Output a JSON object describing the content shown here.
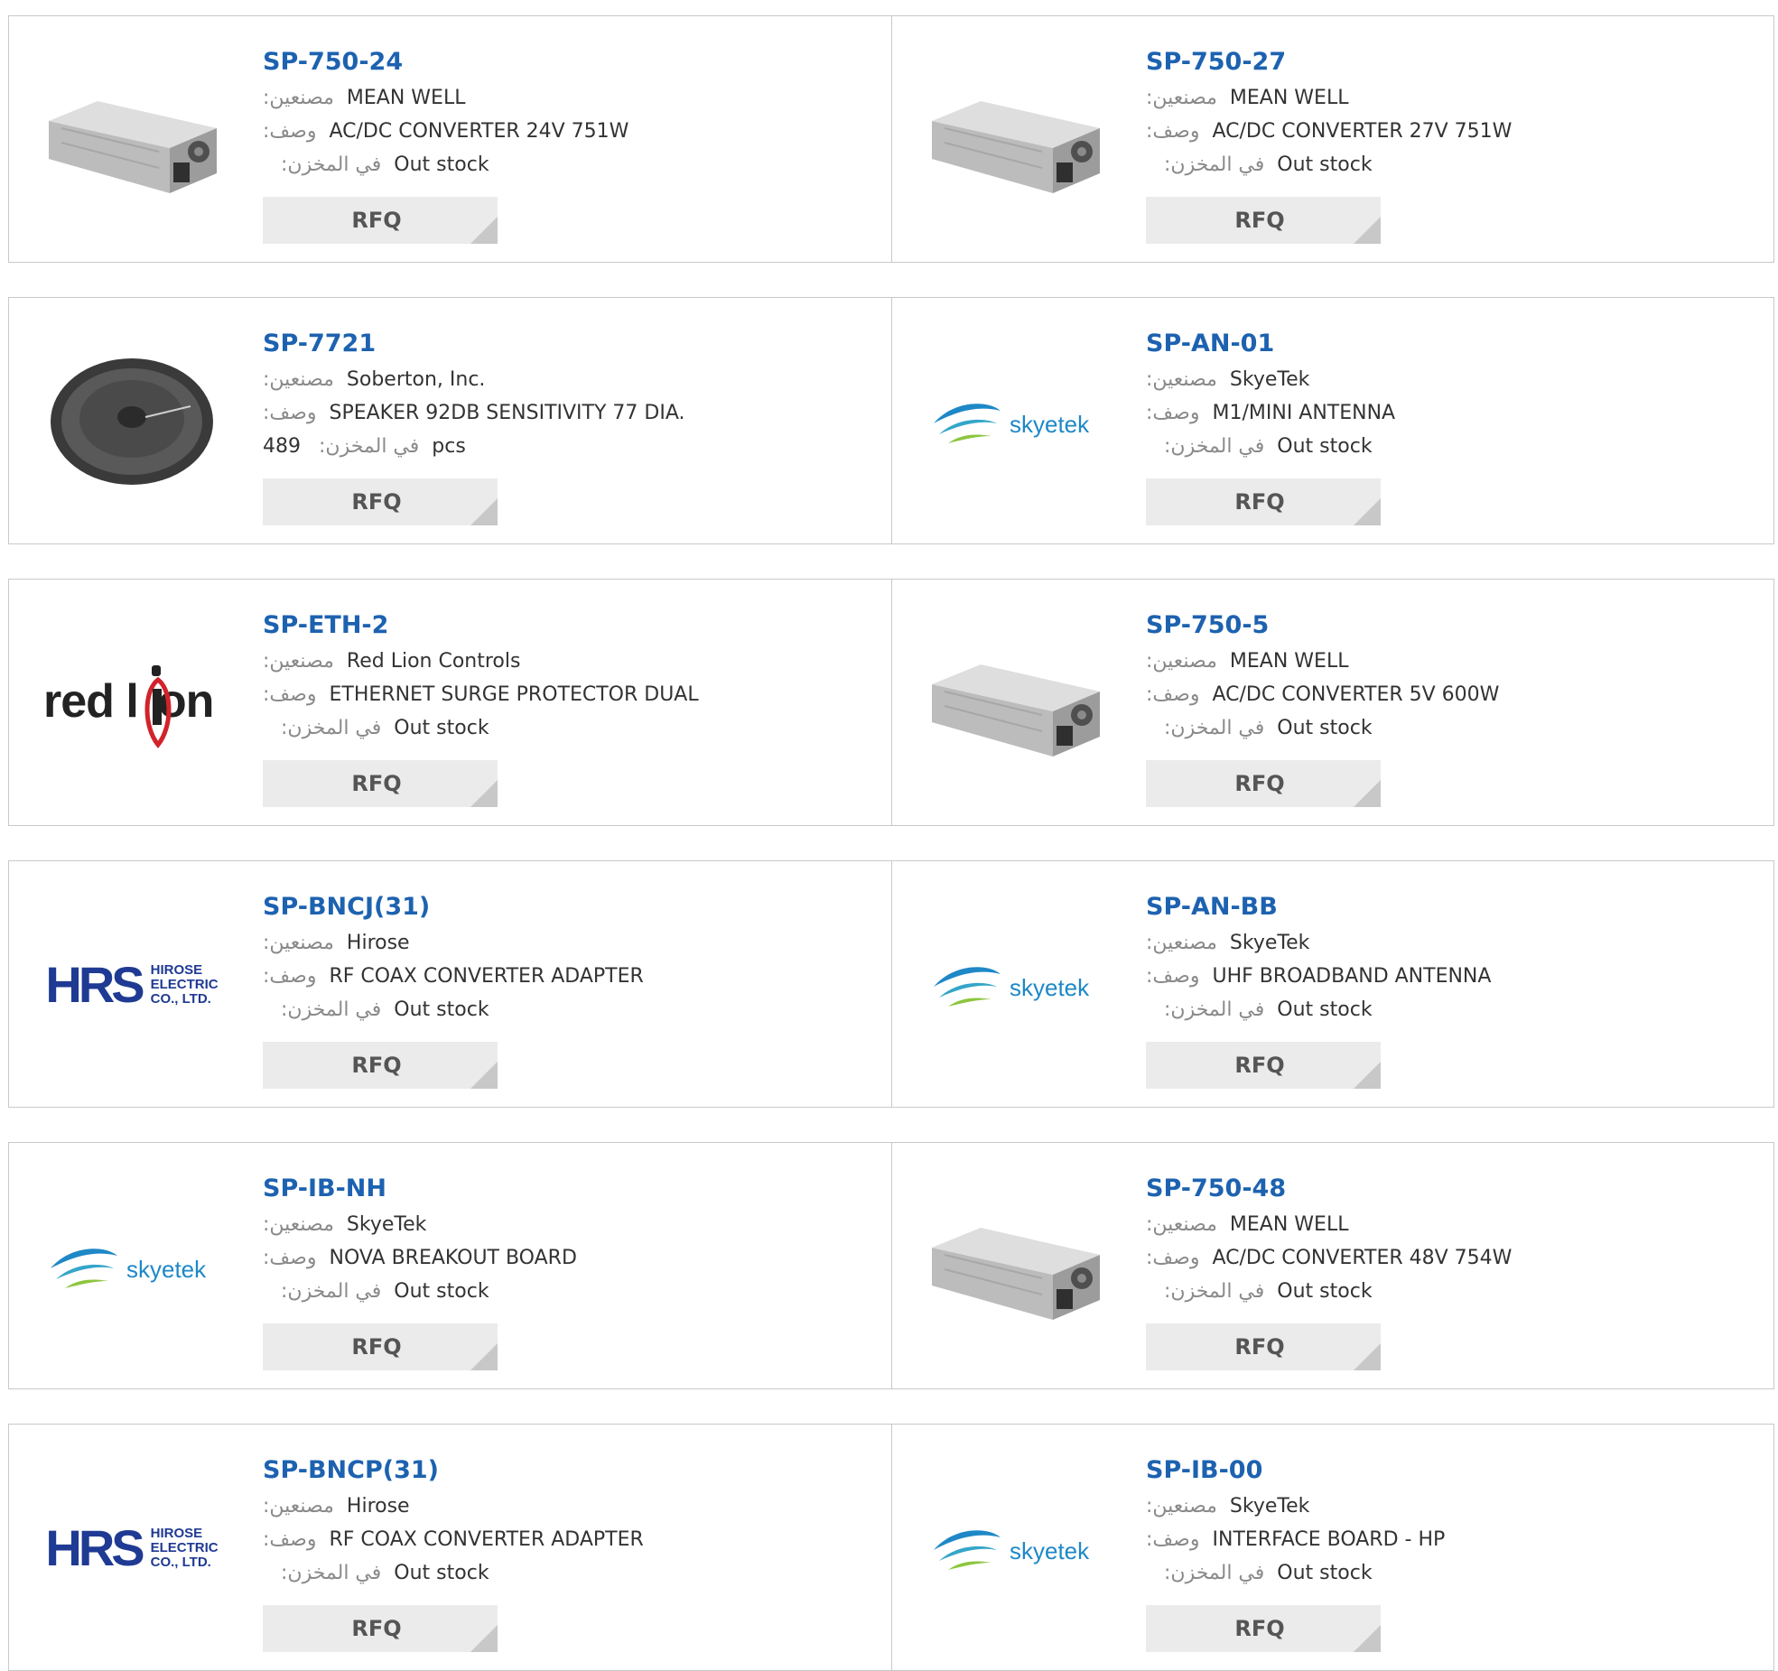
{
  "labels": {
    "manufacturer": "مصنعين:",
    "description": "وصف:",
    "stock": "في المخزن:",
    "rfq": "RFQ"
  },
  "brand_text": {
    "skyetek": "skyetek",
    "redlion_a": "red l",
    "redlion_b": "on",
    "hrs_mark": "HRS",
    "hrs_line1": "HIROSE",
    "hrs_line2": "ELECTRIC",
    "hrs_line3": "CO., LTD."
  },
  "products": [
    {
      "part": "SP-750-24",
      "manufacturer": "MEAN WELL",
      "description": "AC/DC CONVERTER 24V 751W",
      "stock": "Out stock",
      "stock_qty": "",
      "image": "power-supply"
    },
    {
      "part": "SP-750-27",
      "manufacturer": "MEAN WELL",
      "description": "AC/DC CONVERTER 27V 751W",
      "stock": "Out stock",
      "stock_qty": "",
      "image": "power-supply"
    },
    {
      "part": "SP-7721",
      "manufacturer": "Soberton, Inc.",
      "description": "SPEAKER 92DB SENSITIVITY 77 DIA.",
      "stock": "pcs",
      "stock_qty": "489",
      "image": "speaker"
    },
    {
      "part": "SP-AN-01",
      "manufacturer": "SkyeTek",
      "description": "M1/MINI ANTENNA",
      "stock": "Out stock",
      "stock_qty": "",
      "image": "skyetek-logo"
    },
    {
      "part": "SP-ETH-2",
      "manufacturer": "Red Lion Controls",
      "description": "ETHERNET SURGE PROTECTOR DUAL",
      "stock": "Out stock",
      "stock_qty": "",
      "image": "redlion-logo"
    },
    {
      "part": "SP-750-5",
      "manufacturer": "MEAN WELL",
      "description": "AC/DC CONVERTER 5V 600W",
      "stock": "Out stock",
      "stock_qty": "",
      "image": "power-supply"
    },
    {
      "part": "SP-BNCJ(31)",
      "manufacturer": "Hirose",
      "description": "RF COAX CONVERTER ADAPTER",
      "stock": "Out stock",
      "stock_qty": "",
      "image": "hirose-logo"
    },
    {
      "part": "SP-AN-BB",
      "manufacturer": "SkyeTek",
      "description": "UHF BROADBAND ANTENNA",
      "stock": "Out stock",
      "stock_qty": "",
      "image": "skyetek-logo"
    },
    {
      "part": "SP-IB-NH",
      "manufacturer": "SkyeTek",
      "description": "NOVA BREAKOUT BOARD",
      "stock": "Out stock",
      "stock_qty": "",
      "image": "skyetek-logo"
    },
    {
      "part": "SP-750-48",
      "manufacturer": "MEAN WELL",
      "description": "AC/DC CONVERTER 48V 754W",
      "stock": "Out stock",
      "stock_qty": "",
      "image": "power-supply"
    },
    {
      "part": "SP-BNCP(31)",
      "manufacturer": "Hirose",
      "description": "RF COAX CONVERTER ADAPTER",
      "stock": "Out stock",
      "stock_qty": "",
      "image": "hirose-logo"
    },
    {
      "part": "SP-IB-00",
      "manufacturer": "SkyeTek",
      "description": "INTERFACE BOARD - HP",
      "stock": "Out stock",
      "stock_qty": "",
      "image": "skyetek-logo"
    }
  ],
  "colors": {
    "link": "#1d62b0",
    "label": "#8a8a8a",
    "border": "#c9c9c9",
    "button_bg": "#ebebeb",
    "redlion_red": "#d2232a",
    "hirose_blue": "#1f3a93",
    "skyetek_blue": "#1e88c7"
  }
}
